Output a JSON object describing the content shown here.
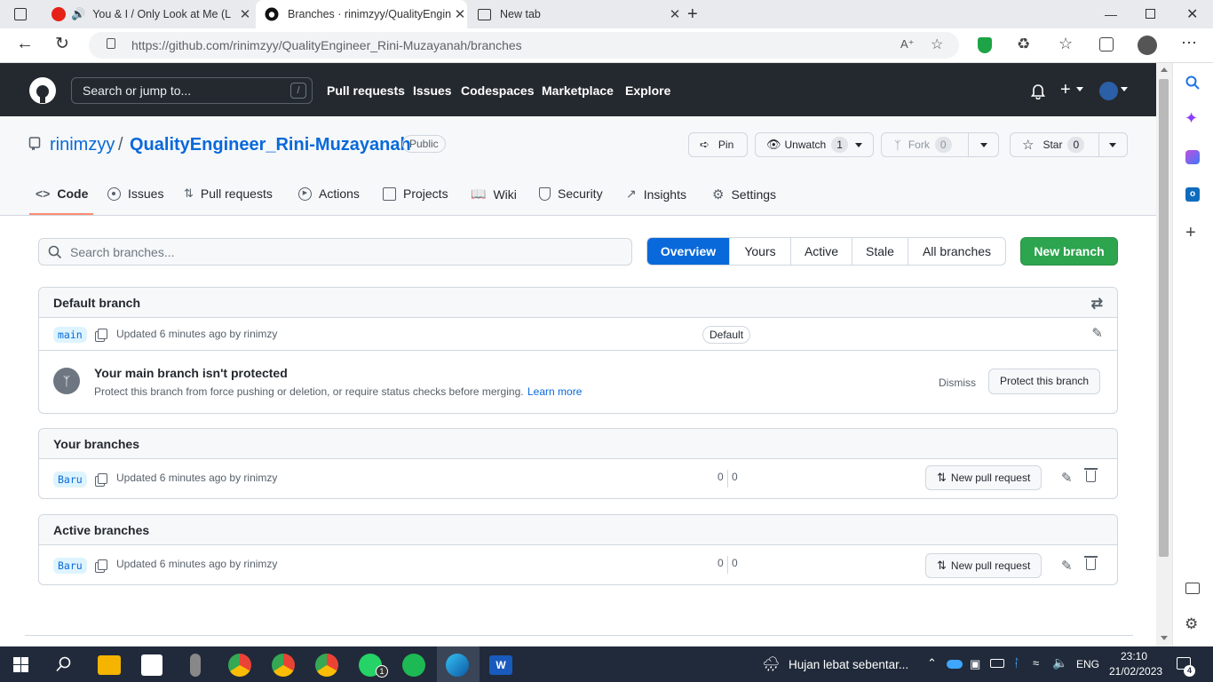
{
  "browser": {
    "tabs": [
      {
        "title": "You & I / Only Look at Me (L",
        "active": false
      },
      {
        "title": "Branches · rinimzyy/QualityEngin",
        "active": true
      },
      {
        "title": "New tab",
        "active": false
      }
    ],
    "url": "https://github.com/rinimzyy/QualityEngineer_Rini-Muzayanah/branches"
  },
  "gh_header": {
    "search_placeholder": "Search or jump to...",
    "slash_hint": "/",
    "nav": [
      "Pull requests",
      "Issues",
      "Codespaces",
      "Marketplace",
      "Explore"
    ]
  },
  "repo": {
    "owner": "rinimzyy",
    "separator": "/",
    "name": "QualityEngineer_Rini-Muzayanah",
    "visibility": "Public",
    "pin_label": "Pin",
    "unwatch_label": "Unwatch",
    "watch_count": "1",
    "fork_label": "Fork",
    "fork_count": "0",
    "star_label": "Star",
    "star_count": "0",
    "tabs": [
      "Code",
      "Issues",
      "Pull requests",
      "Actions",
      "Projects",
      "Wiki",
      "Security",
      "Insights",
      "Settings"
    ]
  },
  "branches": {
    "search_placeholder": "Search branches...",
    "filters": [
      "Overview",
      "Yours",
      "Active",
      "Stale",
      "All branches"
    ],
    "new_branch_label": "New branch",
    "default_section": {
      "title": "Default branch",
      "branch": "main",
      "updated": "Updated 6 minutes ago by rinimzy",
      "badge": "Default",
      "protect_title": "Your main branch isn't protected",
      "protect_text": "Protect this branch from force pushing or deletion, or require status checks before merging.",
      "learn_more": "Learn more",
      "dismiss_label": "Dismiss",
      "protect_button": "Protect this branch"
    },
    "your_section": {
      "title": "Your branches",
      "branch": "Baru",
      "updated": "Updated 6 minutes ago by rinimzy",
      "behind": "0",
      "ahead": "0",
      "pr_label": "New pull request"
    },
    "active_section": {
      "title": "Active branches",
      "branch": "Baru",
      "updated": "Updated 6 minutes ago by rinimzy",
      "behind": "0",
      "ahead": "0",
      "pr_label": "New pull request"
    }
  },
  "taskbar": {
    "weather": "Hujan lebat sebentar...",
    "lang": "ENG",
    "time": "23:10",
    "date": "21/02/2023",
    "notif_count": "4",
    "whatsapp_badge": "1"
  },
  "colors": {
    "gh_header": "#24292f",
    "primary_blue": "#0969da",
    "green_button": "#2da44e",
    "accent_underline": "#fd8c73"
  }
}
